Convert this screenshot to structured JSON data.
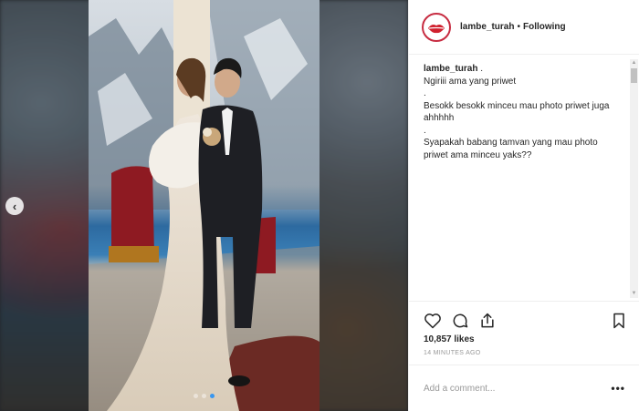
{
  "account": {
    "username": "lambe_turah",
    "separator": "•",
    "follow_status": "Following",
    "avatar_text": "LAMBE TURAH"
  },
  "caption": {
    "username": "lambe_turah",
    "lines": [
      ".",
      "Ngiriii ama yang priwet",
      ".",
      "Besokk besokk minceu mau photo priwet juga ahhhhh",
      ".",
      "Syapakah babang tamvan yang mau photo priwet ama minceu yaks??"
    ]
  },
  "actions": {
    "icons": [
      "heart-icon",
      "comment-icon",
      "share-icon",
      "bookmark-icon"
    ]
  },
  "likes_text": "10,857 likes",
  "time_text": "14 MINUTES AGO",
  "comment": {
    "placeholder": "Add a comment...",
    "more": "•••"
  },
  "carousel": {
    "total": 3,
    "active": 3,
    "prev": "‹"
  },
  "colors": {
    "accent": "#3897f0",
    "brand": "#c72c41"
  }
}
